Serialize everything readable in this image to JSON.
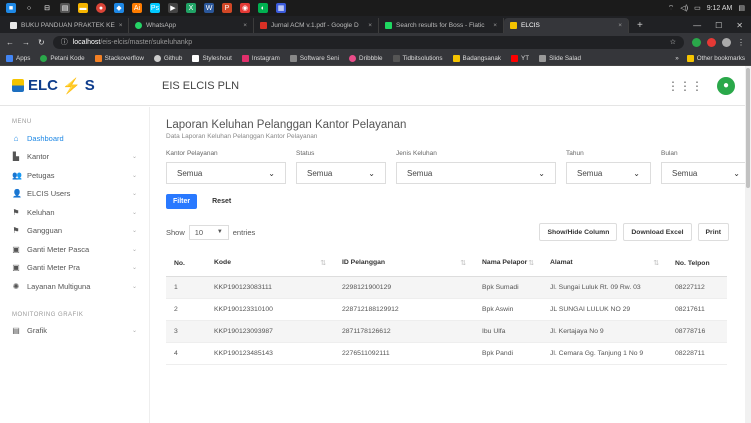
{
  "taskbar": {
    "time": "9:12 AM"
  },
  "browser": {
    "tabs": [
      {
        "label": "BUKU PANDUAN PRAKTEK KE",
        "color": "#e8e8e8"
      },
      {
        "label": "WhatsApp",
        "color": "#25d366"
      },
      {
        "label": "Jurnal ACM v.1.pdf - Google D",
        "color": "#d93025"
      },
      {
        "label": "Search results for Boss - Flatic",
        "color": "#1ed760"
      },
      {
        "label": "ELCIS",
        "color": "#f5c400"
      }
    ],
    "url_host": "localhost",
    "url_path": "/eis-elcis/master/sukeluhankp",
    "bookmarks": [
      {
        "label": "Apps",
        "color": "#4285f4"
      },
      {
        "label": "Petani Kode",
        "color": "#2aa84a"
      },
      {
        "label": "Stackoverflow",
        "color": "#f48024"
      },
      {
        "label": "Github",
        "color": "#cccccc"
      },
      {
        "label": "Styleshout",
        "color": "#ffffff"
      },
      {
        "label": "Instagram",
        "color": "#e1306c"
      },
      {
        "label": "Software Seni",
        "color": "#888888"
      },
      {
        "label": "Dribbble",
        "color": "#ea4c89"
      },
      {
        "label": "Tidbitsolutions",
        "color": "#555555"
      },
      {
        "label": "Badangsanak",
        "color": "#f5c400"
      },
      {
        "label": "YT",
        "color": "#ff0000"
      },
      {
        "label": "Slide Salad",
        "color": "#999999"
      }
    ],
    "other_bookmarks": "Other bookmarks"
  },
  "header": {
    "logo_text": "ELC",
    "logo_bolt": "⚡",
    "logo_tail": "S",
    "title": "EIS ELCIS PLN"
  },
  "sidebar": {
    "menu_label": "MENU",
    "items": [
      {
        "label": "Dashboard",
        "icon": "home-icon",
        "glyph": "⌂",
        "chevron": false,
        "active": true
      },
      {
        "label": "Kantor",
        "icon": "building-icon",
        "glyph": "▙",
        "chevron": true,
        "active": false
      },
      {
        "label": "Petugas",
        "icon": "users-icon",
        "glyph": "👥",
        "chevron": true,
        "active": false
      },
      {
        "label": "ELCIS Users",
        "icon": "user-icon",
        "glyph": "👤",
        "chevron": true,
        "active": false
      },
      {
        "label": "Keluhan",
        "icon": "flag-icon",
        "glyph": "⚑",
        "chevron": true,
        "active": false
      },
      {
        "label": "Gangguan",
        "icon": "flag-icon",
        "glyph": "⚑",
        "chevron": true,
        "active": false
      },
      {
        "label": "Ganti Meter Pasca",
        "icon": "meter-icon",
        "glyph": "▣",
        "chevron": true,
        "active": false
      },
      {
        "label": "Ganti Meter Pra",
        "icon": "meter-icon",
        "glyph": "▣",
        "chevron": true,
        "active": false
      },
      {
        "label": "Layanan Multiguna",
        "icon": "bolt-icon",
        "glyph": "✺",
        "chevron": true,
        "active": false
      }
    ],
    "monitoring_label": "MONITORING GRAFIK",
    "grafik": {
      "label": "Grafik",
      "icon": "chart-icon",
      "glyph": "▤"
    }
  },
  "main": {
    "title": "Laporan Keluhan Pelanggan Kantor Pelayanan",
    "subtitle": "Data Laporan Keluhan Pelanggan Kantor Pelayanan",
    "filters": [
      {
        "label": "Kantor Pelayanan",
        "value": "Semua",
        "width": 0
      },
      {
        "label": "Status",
        "value": "Semua",
        "width": 0
      },
      {
        "label": "Jenis Keluhan",
        "value": "Semua",
        "width": 0
      },
      {
        "label": "Tahun",
        "value": "Semua",
        "width": 0
      },
      {
        "label": "Bulan",
        "value": "Semua",
        "width": 0
      }
    ],
    "filter_btn": "Filter",
    "reset_btn": "Reset",
    "show_label": "Show",
    "show_value": "10",
    "entries_label": "entries",
    "tool_buttons": [
      "Show/Hide Column",
      "Download Excel",
      "Print"
    ],
    "columns": [
      "No.",
      "Kode",
      "ID Pelanggan",
      "Nama Pelapor",
      "Alamat",
      "No. Telpon"
    ],
    "rows": [
      [
        "1",
        "KKP190123083111",
        "2298121900129",
        "Bpk Sumadi",
        "Jl. Sungai Luluk Rt. 09 Rw. 03",
        "08227112"
      ],
      [
        "2",
        "KKP190123310100",
        "228712188129912",
        "Bpk Aswin",
        "JL SUNGAI LULUK NO 29",
        "08217611"
      ],
      [
        "3",
        "KKP190123093987",
        "2871178126612",
        "Ibu Ulfa",
        "Jl. Kertajaya No 9",
        "08778716"
      ],
      [
        "4",
        "KKP190123485143",
        "2276511092111",
        "Bpk Pandi",
        "Jl. Cemara Gg. Tanjung 1 No 9",
        "08228711"
      ]
    ]
  }
}
